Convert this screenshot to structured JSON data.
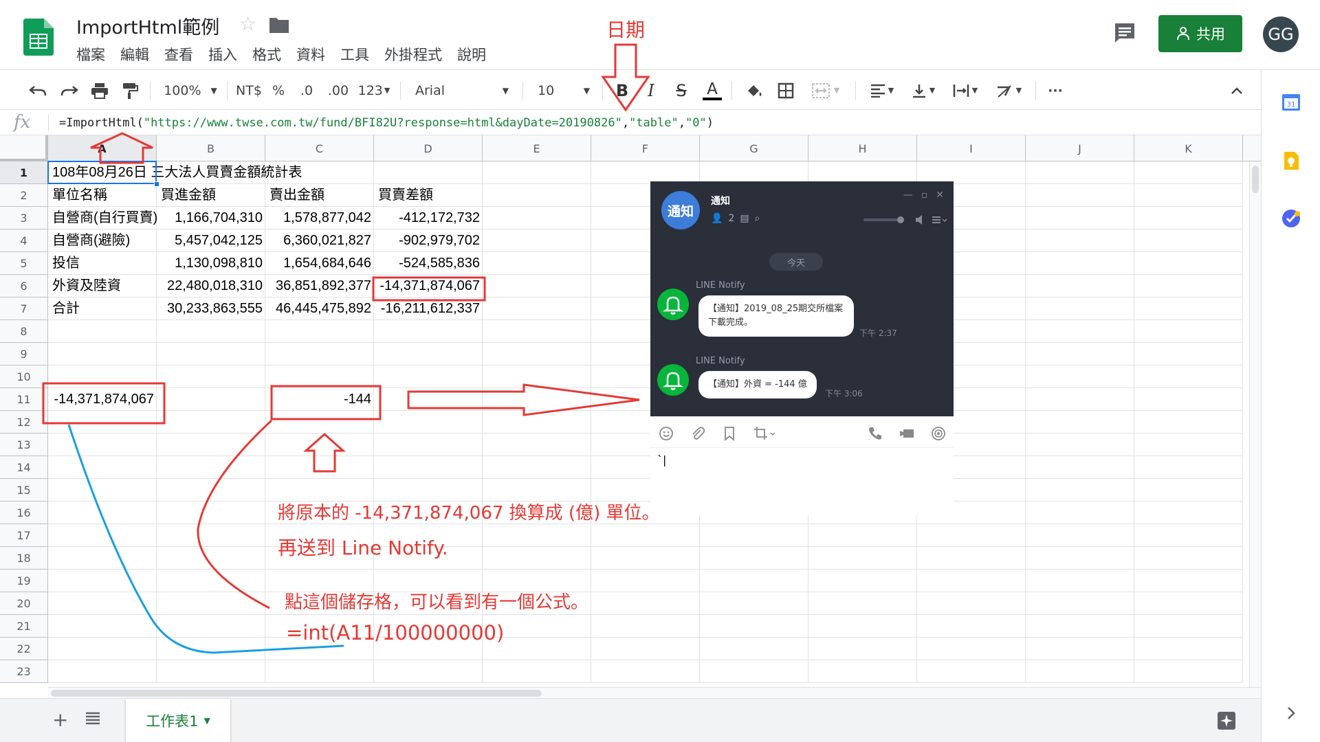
{
  "header": {
    "title": "ImportHtml範例",
    "menu": [
      "檔案",
      "編輯",
      "查看",
      "插入",
      "格式",
      "資料",
      "工具",
      "外掛程式",
      "說明"
    ],
    "share_label": "共用",
    "avatar_initials": "GG",
    "colors": {
      "brand_green": "#188038",
      "sheets_green": "#0f9d58",
      "accent_blue": "#1a73e8"
    }
  },
  "toolbar": {
    "zoom": "100%",
    "currency": "NT$",
    "percent": "%",
    "decrease_decimal": ".0",
    "increase_decimal": ".00",
    "more_formats": "123",
    "font": "Arial",
    "font_size": "10",
    "bold": "B",
    "italic": "I",
    "strike": "S",
    "text_color": "A",
    "more": "···"
  },
  "formula_bar": {
    "fx": "fx",
    "prefix": "=ImportHtml(",
    "arg_url": "\"https://www.twse.com.tw/fund/BFI82U?response=html&dayDate=20190826\"",
    "comma1": ",",
    "arg_table": "\"table\"",
    "comma2": ",",
    "arg_index": "\"0\"",
    "suffix": ")"
  },
  "grid": {
    "columns": [
      "A",
      "B",
      "C",
      "D",
      "E",
      "F",
      "G",
      "H",
      "I",
      "J",
      "K"
    ],
    "rows": [
      "1",
      "2",
      "3",
      "4",
      "5",
      "6",
      "7",
      "8",
      "9",
      "10",
      "11",
      "12",
      "13",
      "14",
      "15",
      "16",
      "17",
      "18",
      "19",
      "20",
      "21",
      "22",
      "23"
    ],
    "cells": {
      "A1": "108年08月26日 三大法人買賣金額統計表",
      "A2": "單位名稱",
      "B2": "買進金額",
      "C2": "賣出金額",
      "D2": "買賣差額",
      "A3": "自營商(自行買賣)",
      "B3": "1,166,704,310",
      "C3": "1,578,877,042",
      "D3": "-412,172,732",
      "A4": "自營商(避險)",
      "B4": "5,457,042,125",
      "C4": "6,360,021,827",
      "D4": "-902,979,702",
      "A5": "投信",
      "B5": "1,130,098,810",
      "C5": "1,654,684,646",
      "D5": "-524,585,836",
      "A6": "外資及陸資",
      "B6": "22,480,018,310",
      "C6": "36,851,892,377",
      "D6": "-14,371,874,067",
      "A7": "合計",
      "B7": "30,233,863,555",
      "C7": "46,445,475,892",
      "D7": "-16,211,612,337",
      "A11": "-14,371,874,067",
      "C11": "-144"
    }
  },
  "sheet_tabs": [
    {
      "label": "工作表1"
    }
  ],
  "line_chat": {
    "avatar_text": "通知",
    "title": "通知",
    "member_count": "2",
    "date_label": "今天",
    "messages": [
      {
        "sender": "LINE Notify",
        "text": "【通知】2019_08_25期交所檔案下載完成。",
        "time": "下午 2:37"
      },
      {
        "sender": "LINE Notify",
        "text": "【通知】外資 = -144 億",
        "time": "下午 3:06"
      }
    ],
    "input_value": "`|"
  },
  "annotations": {
    "date_label": "日期",
    "note_line1": "將原本的 -14,371,874,067 換算成 (億) 單位。",
    "note_line2": "再送到 Line Notify.",
    "note_line3": "點這個儲存格，可以看到有一個公式。",
    "note_formula": "=int(A11/100000000)",
    "color": "#e53935",
    "line_color": "#1a9fe0"
  }
}
